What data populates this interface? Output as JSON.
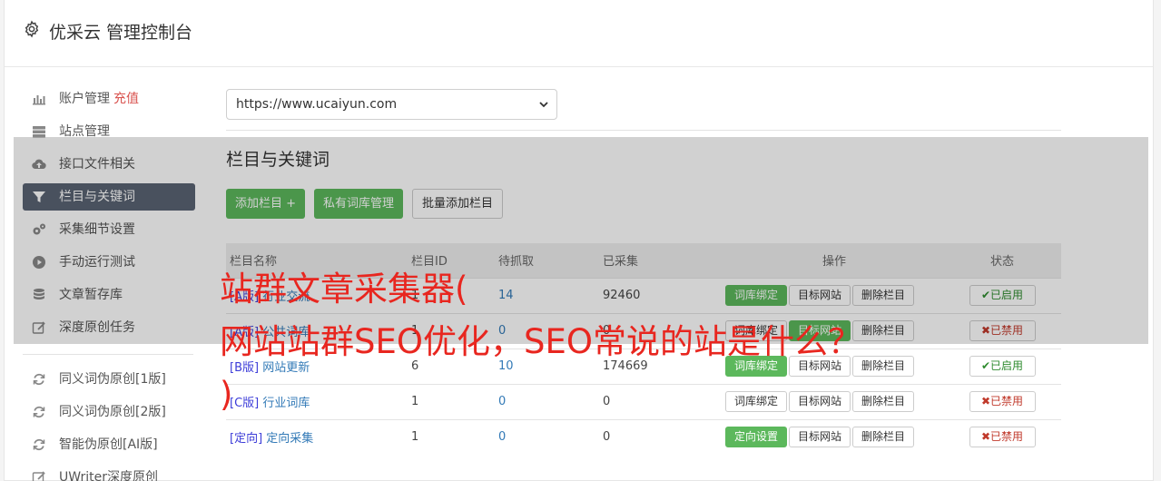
{
  "header": {
    "title": "优采云 管理控制台",
    "icon": "gear-icon"
  },
  "sidebar": {
    "items": [
      {
        "label": "账户管理",
        "extra": "充值",
        "icon": "bar-chart-icon"
      },
      {
        "label": "站点管理",
        "icon": "server-icon"
      },
      {
        "label": "接口文件相关",
        "icon": "cloud-upload-icon"
      },
      {
        "label": "栏目与关键词",
        "icon": "filter-icon"
      },
      {
        "label": "采集细节设置",
        "icon": "cogs-icon"
      },
      {
        "label": "手动运行测试",
        "icon": "play-circle-icon"
      },
      {
        "label": "文章暂存库",
        "icon": "database-icon"
      },
      {
        "label": "深度原创任务",
        "icon": "edit-icon"
      }
    ],
    "items2": [
      {
        "label": "同义词伪原创[1版]",
        "icon": "refresh-icon"
      },
      {
        "label": "同义词伪原创[2版]",
        "icon": "refresh-icon"
      },
      {
        "label": "智能伪原创[AI版]",
        "icon": "refresh-icon"
      },
      {
        "label": "UWriter深度原创",
        "icon": "edit-icon"
      }
    ]
  },
  "site_select": {
    "value": "https://www.ucaiyun.com"
  },
  "section": {
    "title": "栏目与关键词",
    "buttons": {
      "add": "添加栏目 +",
      "private": "私有词库管理",
      "batch": "批量添加栏目"
    }
  },
  "table": {
    "headers": [
      "栏目名称",
      "栏目ID",
      "待抓取",
      "已采集",
      "操作",
      "状态"
    ],
    "rows": [
      {
        "tag": "[A版]",
        "name": "行业交流",
        "id": "1",
        "pending": "14",
        "collected": "92460",
        "op1": "词库绑定",
        "op2": "目标网站",
        "op3": "删除栏目",
        "status": "✔已启用",
        "enabled": true
      },
      {
        "tag": "[A版]",
        "name": "公共词库",
        "id": "1",
        "pending": "0",
        "collected": "0",
        "op1": "词库绑定",
        "op2": "目标网站",
        "op3": "删除栏目",
        "status": "✖已禁用",
        "enabled": false
      },
      {
        "tag": "[B版]",
        "name": "网站更新",
        "id": "6",
        "pending": "10",
        "collected": "174669",
        "op1": "词库绑定",
        "op2": "目标网站",
        "op3": "删除栏目",
        "status": "✔已启用",
        "enabled": true
      },
      {
        "tag": "[C版]",
        "name": "行业词库",
        "id": "1",
        "pending": "0",
        "collected": "0",
        "op1": "词库绑定",
        "op2": "目标网站",
        "op3": "删除栏目",
        "status": "✖已禁用",
        "enabled": false
      },
      {
        "tag": "[定向]",
        "name": "定向采集",
        "id": "1",
        "pending": "0",
        "collected": "0",
        "op1": "定向设置",
        "op2": "目标网站",
        "op3": "删除栏目",
        "status": "✖已禁用",
        "enabled": false
      }
    ]
  },
  "promo": {
    "line1": "站群文章采集器(",
    "line2": "网站站群SEO优化，SEO常说的站是什么？",
    "line3": ")",
    "color": "#e8261f"
  }
}
